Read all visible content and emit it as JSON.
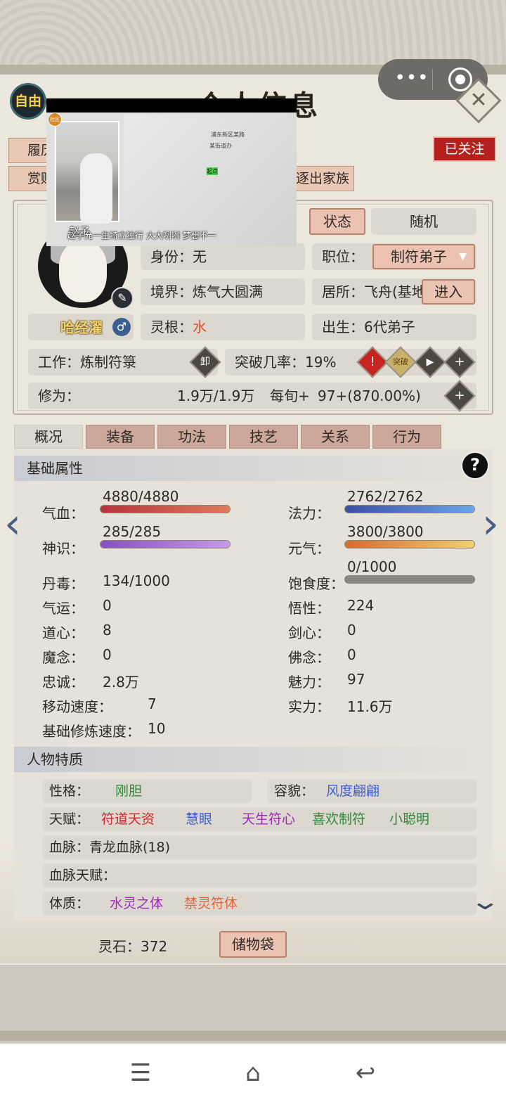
{
  "header": {
    "title": "个人信息",
    "free_label": "自由",
    "follow_label": "已关注",
    "close_symbol": "✕",
    "menu_symbol": "•••"
  },
  "actions": {
    "resume_partial": "履历",
    "reward_partial": "赏赐",
    "expel_label": "逐出家族"
  },
  "profile": {
    "name": "哈经濯",
    "gender_symbol": "♂",
    "edit_symbol": "✎",
    "status_tab": "状态",
    "random_tab": "随机",
    "identity_label": "身份：",
    "identity_value": "无",
    "position_label": "职位：",
    "position_value": "制符弟子",
    "realm_label": "境界：",
    "realm_value": "炼气大圆满",
    "residence_label": "居所：",
    "residence_value": "飞舟(基地",
    "enter_label": "进入",
    "root_label": "灵根：",
    "root_value": "水",
    "birth_label": "出生：",
    "birth_value": "6代弟子",
    "job_label": "工作：",
    "job_value": "炼制符箓",
    "job_badge": "卸",
    "breakthrough_label": "突破几率：",
    "breakthrough_value": "19%",
    "breakthrough_badge": "突破",
    "cultivation_label": "修为：",
    "cultivation_value": "1.9万/1.9万",
    "per_turn_label": "每旬+",
    "per_turn_value": "97+(870.00%)"
  },
  "tabs": [
    "概况",
    "装备",
    "功法",
    "技艺",
    "关系",
    "行为"
  ],
  "base_attributes": {
    "title": "基础属性",
    "help_symbol": "?",
    "hp": {
      "label": "气血：",
      "value": "4880/4880",
      "fill": 1.0
    },
    "mana": {
      "label": "法力：",
      "value": "2762/2762",
      "fill": 1.0
    },
    "spirit": {
      "label": "神识：",
      "value": "285/285",
      "fill": 1.0
    },
    "yuanqi": {
      "label": "元气：",
      "value": "3800/3800",
      "fill": 1.0
    },
    "satiety": {
      "label": "饱食度：",
      "value": "0/1000",
      "fill": 0.0
    },
    "stats_left": [
      {
        "label": "丹毒：",
        "value": "134/1000"
      },
      {
        "label": "气运：",
        "value": "0"
      },
      {
        "label": "道心：",
        "value": "8"
      },
      {
        "label": "魔念：",
        "value": "0"
      },
      {
        "label": "忠诚：",
        "value": "2.8万"
      },
      {
        "label": "移动速度：",
        "value": "7"
      },
      {
        "label": "基础修炼速度：",
        "value": "10"
      }
    ],
    "stats_right": [
      {
        "label": "悟性：",
        "value": "224"
      },
      {
        "label": "剑心：",
        "value": "0"
      },
      {
        "label": "佛念：",
        "value": "0"
      },
      {
        "label": "魅力：",
        "value": "97"
      },
      {
        "label": "实力：",
        "value": "11.6万"
      }
    ]
  },
  "traits": {
    "title": "人物特质",
    "personality_label": "性格：",
    "personality_value": "刚胆",
    "looks_label": "容貌：",
    "looks_value": "风度翩翩",
    "talent_label": "天赋：",
    "talents": [
      "符道天资",
      "慧眼",
      "天生符心",
      "喜欢制符",
      "小聪明"
    ],
    "bloodline_label": "血脉：",
    "bloodline_value": "青龙血脉(18)",
    "bloodline_talent_label": "血脉天赋：",
    "physique_label": "体质：",
    "physiques": [
      "水灵之体",
      "禁灵符体"
    ]
  },
  "footer": {
    "stone_label": "灵石：",
    "stone_value": "372",
    "bag_label": "储物袋"
  },
  "overlay": {
    "person_name": "赵子",
    "caption": "赵子允一生特立独行 大大咧咧 梦想不一",
    "badge_text": "社区",
    "map_text_1": "浦东新区某路",
    "map_text_2": "某街道办",
    "map_text_3": "起点"
  },
  "colors": {
    "hp_bar": "#c0413e",
    "mana_bar": "#4a79c8",
    "spirit_bar": "#9a5fc6",
    "yuanqi_bar": "#e08a3b",
    "talent_red": "#d4262b",
    "talent_blue": "#3b5fd0",
    "talent_purple": "#a02ab8",
    "talent_green": "#2f8a3a",
    "water_root": "#e0502a"
  },
  "navbar": {
    "menu_icon": "☰",
    "home_icon": "⌂",
    "back_icon": "↩"
  }
}
